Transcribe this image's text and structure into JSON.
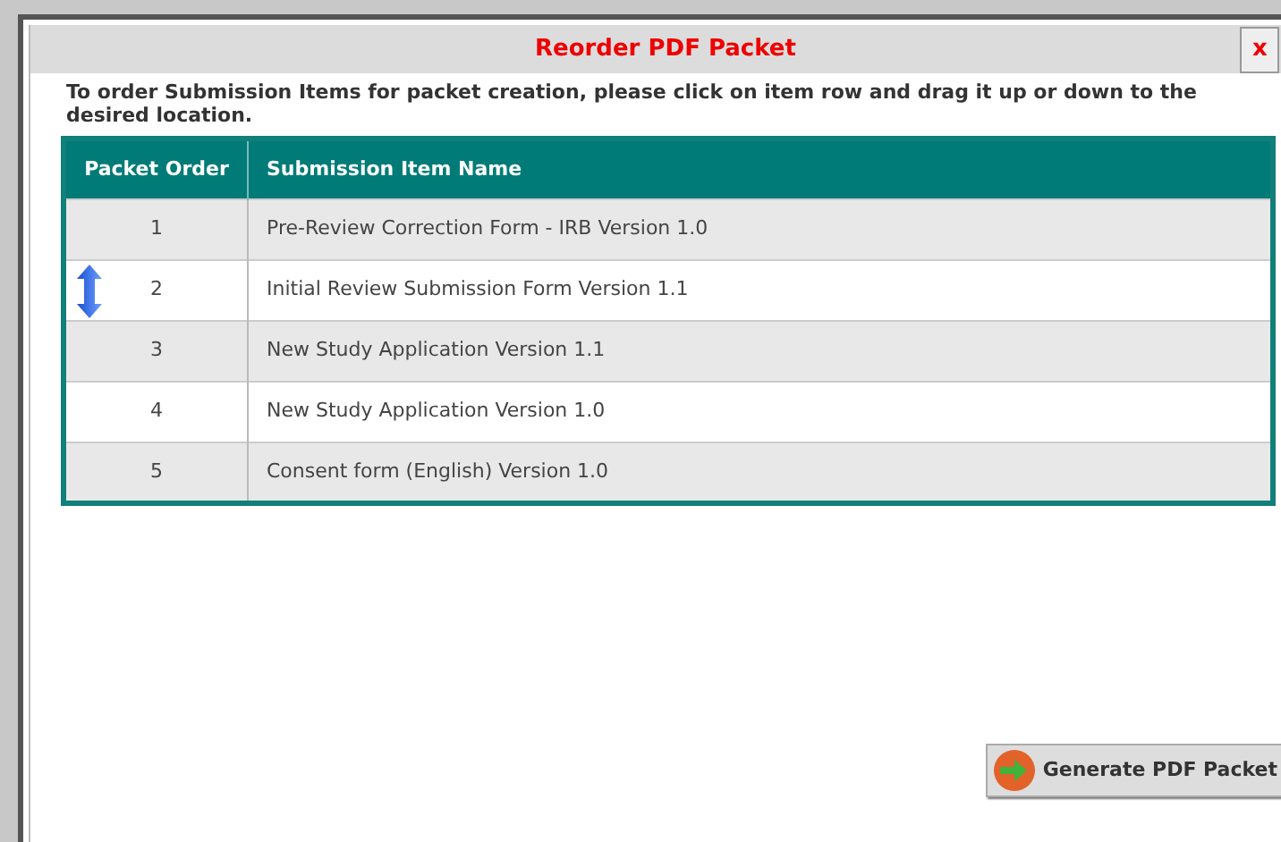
{
  "dialog": {
    "title": "Reorder PDF Packet",
    "close_label": "x",
    "instructions": "To order Submission Items for packet creation, please click on item row and drag it up or down to the desired location.",
    "table": {
      "columns": [
        "Packet Order",
        "Submission Item Name"
      ],
      "rows": [
        {
          "order": "1",
          "name": "Pre-Review Correction Form - IRB Version 1.0",
          "hovered": false
        },
        {
          "order": "2",
          "name": "Initial Review Submission Form Version 1.1",
          "hovered": true
        },
        {
          "order": "3",
          "name": "New Study Application Version 1.1",
          "hovered": false
        },
        {
          "order": "4",
          "name": "New Study Application Version 1.0",
          "hovered": false
        },
        {
          "order": "5",
          "name": "Consent form (English) Version 1.0",
          "hovered": false
        }
      ]
    },
    "button": "Generate PDF Packet"
  }
}
